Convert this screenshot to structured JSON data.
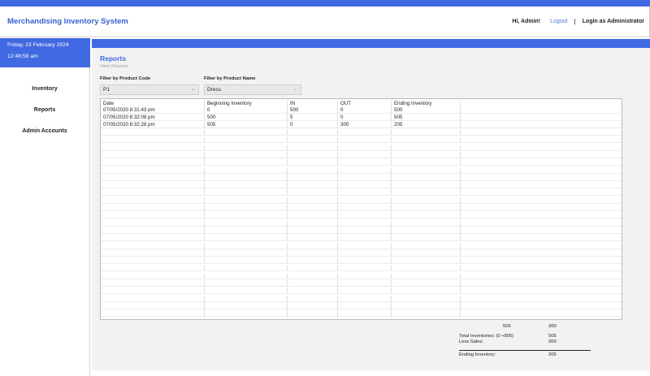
{
  "app": {
    "title": "Merchandising Inventory System",
    "greeting": "Hi, Admin!",
    "logout_label": "Logout",
    "separator": "|",
    "login_as": "Login as Administrator",
    "accent_color": "#4169e1"
  },
  "sidebar": {
    "date": "Friday, 23 February 2024",
    "time": "12:48:58 am",
    "items": [
      {
        "label": "Inventory"
      },
      {
        "label": "Reports"
      },
      {
        "label": "Admin Accounts"
      }
    ]
  },
  "page": {
    "title": "Reports",
    "subtitle": "View Reports"
  },
  "filters": {
    "product_code": {
      "label": "Filter by Product Code",
      "value": "P1"
    },
    "product_name": {
      "label": "Filter by Product Name",
      "value": "Dress"
    }
  },
  "table": {
    "columns": [
      "Date",
      "Beginning Inventory",
      "IN",
      "OUT",
      "Ending Inventory",
      ""
    ],
    "rows": [
      [
        "07/05/2020 8:31:43 pm",
        "0",
        "500",
        "0",
        "500",
        ""
      ],
      [
        "07/05/2020 8:32:08 pm",
        "500",
        "5",
        "0",
        "505",
        ""
      ],
      [
        "07/05/2020 8:32:28 pm",
        "505",
        "0",
        "300",
        "205",
        ""
      ]
    ]
  },
  "totals": {
    "sum_in": "505",
    "sum_out": "300",
    "total_inventories_label": "Total Inventories: (0 +505)",
    "total_inventories_value": "505",
    "less_sales_label": "Less Sales:",
    "less_sales_value": "300",
    "ending_inventory_label": "Ending Inventory:",
    "ending_inventory_value": "205"
  },
  "icons": {
    "dropdown": "chevron-down-icon"
  }
}
